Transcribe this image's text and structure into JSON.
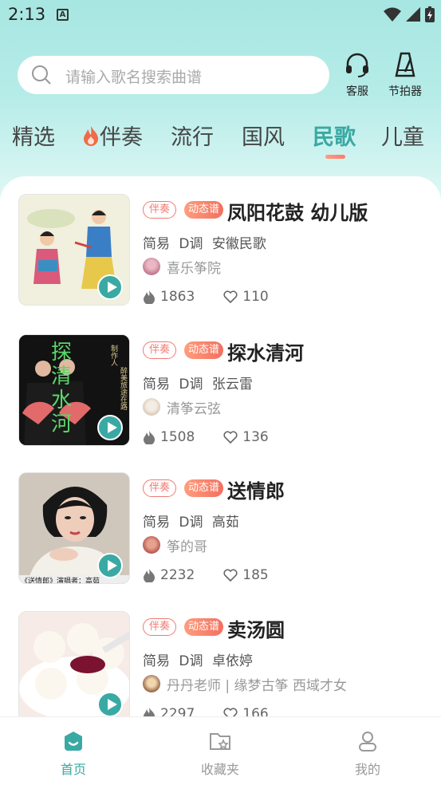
{
  "status_bar": {
    "time": "2:13",
    "notification_letter": "A"
  },
  "search": {
    "placeholder": "请输入歌名搜索曲谱"
  },
  "header_actions": [
    {
      "label": "客服",
      "icon": "headset-icon"
    },
    {
      "label": "节拍器",
      "icon": "metronome-icon"
    }
  ],
  "tabs": [
    {
      "label": "精选",
      "active": false
    },
    {
      "label": "伴奏",
      "active": false,
      "icon": "flame-icon"
    },
    {
      "label": "流行",
      "active": false
    },
    {
      "label": "国风",
      "active": false
    },
    {
      "label": "民歌",
      "active": true
    },
    {
      "label": "儿童",
      "active": false
    }
  ],
  "badges": {
    "accompaniment": "伴奏",
    "dynamic_score": "动态谱"
  },
  "items": [
    {
      "title": "凤阳花鼓 幼儿版",
      "notation": "简易",
      "key": "D调",
      "artist": "安徽民歌",
      "author": "喜乐筝院",
      "plays": "1863",
      "likes": "110"
    },
    {
      "title": "探水清河",
      "notation": "简易",
      "key": "D调",
      "artist": "张云雷",
      "author": "清筝云弦",
      "plays": "1508",
      "likes": "136"
    },
    {
      "title": "送情郎",
      "notation": "简易",
      "key": "D调",
      "artist": "高茹",
      "author": "筝的哥",
      "plays": "2232",
      "likes": "185"
    },
    {
      "title": "卖汤圆",
      "notation": "简易",
      "key": "D调",
      "artist": "卓依婷",
      "author": "丹丹老师 | 缘梦古筝 西域才女",
      "plays": "2297",
      "likes": "166"
    }
  ],
  "thumb_text": {
    "item2_big": [
      "探",
      "清",
      "水",
      "河"
    ],
    "item2_small_a": "制作人",
    "item2_small_b": "醉美旅途在路",
    "item3_caption": "《送情郎》演唱者：高茹"
  },
  "bottom_nav": [
    {
      "label": "首页",
      "active": true
    },
    {
      "label": "收藏夹",
      "active": false
    },
    {
      "label": "我的",
      "active": false
    }
  ],
  "colors": {
    "accent": "#3aa9a3",
    "badge": "#f07a72",
    "header_bg": "#a7e6e2"
  }
}
